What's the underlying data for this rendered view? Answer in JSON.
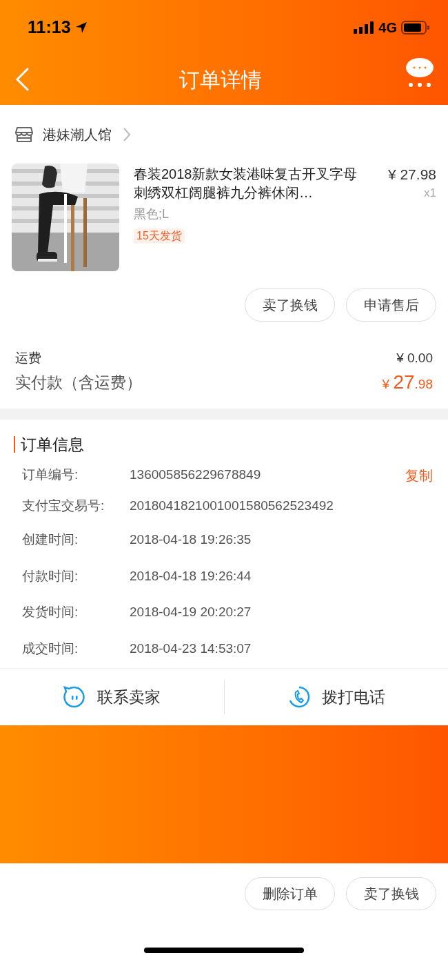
{
  "status_bar": {
    "time": "11:13",
    "network": "4G"
  },
  "nav": {
    "title": "订单详情"
  },
  "shop": {
    "name": "港妹潮人馆"
  },
  "product": {
    "title": "春装2018新款女装港味复古开叉字母刺绣双杠阔腿裤九分裤休闲…",
    "price": "¥ 27.98",
    "quantity": "x1",
    "sku": "黑色;L",
    "tag": "15天发货"
  },
  "item_actions": [
    "卖了换钱",
    "申请售后"
  ],
  "fees": {
    "shipping_label": "运费",
    "shipping_value": "¥ 0.00",
    "paid_label": "实付款（含运费）",
    "paid_currency": "¥ ",
    "paid_integer": "27",
    "paid_decimal": ".98"
  },
  "order_info": {
    "title": "订单信息",
    "rows": [
      {
        "label": "订单编号:",
        "value": "136005856229678849",
        "action": "复制"
      },
      {
        "label": "支付宝交易号:",
        "value": "2018041821001001580562523492"
      },
      {
        "label": "创建时间:",
        "value": "2018-04-18 19:26:35"
      },
      {
        "label": "付款时间:",
        "value": "2018-04-18 19:26:44"
      },
      {
        "label": "发货时间:",
        "value": "2018-04-19 20:20:27"
      },
      {
        "label": "成交时间:",
        "value": "2018-04-23 14:53:07"
      }
    ]
  },
  "contact": [
    {
      "kind": "chat",
      "label": "联系卖家"
    },
    {
      "kind": "phone",
      "label": "拨打电话"
    }
  ],
  "bottom_actions": [
    "删除订单",
    "卖了换钱"
  ]
}
